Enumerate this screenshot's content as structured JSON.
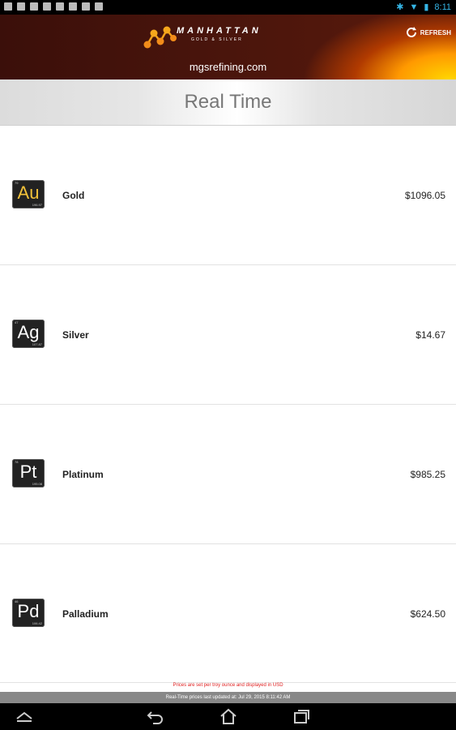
{
  "status": {
    "time": "8:11"
  },
  "header": {
    "logo_text": "MANHATTAN",
    "logo_sub": "GOLD & SILVER",
    "refresh_label": "REFRESH",
    "site": "mgsrefining.com"
  },
  "page_title": "Real Time",
  "metals": [
    {
      "symbol": "Au",
      "name": "Gold",
      "price": "$1096.05",
      "accent": "#f2c23a"
    },
    {
      "symbol": "Ag",
      "name": "Silver",
      "price": "$14.67",
      "accent": "#ffffff"
    },
    {
      "symbol": "Pt",
      "name": "Platinum",
      "price": "$985.25",
      "accent": "#ffffff"
    },
    {
      "symbol": "Pd",
      "name": "Palladium",
      "price": "$624.50",
      "accent": "#ffffff"
    }
  ],
  "footer": {
    "notice": "Prices are set per troy ounce and displayed in USD",
    "updated": "Real-Time prices last updated at: Jul 29, 2015 8:11:42 AM"
  },
  "colors": {
    "status_accent": "#35b5e5",
    "notice": "#e02020"
  }
}
